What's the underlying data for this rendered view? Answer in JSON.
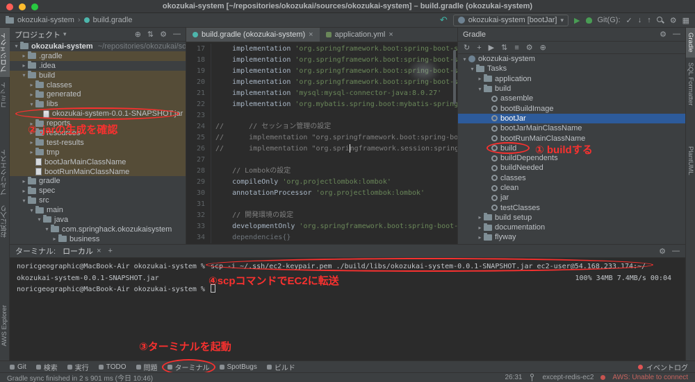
{
  "title_bar": {
    "title": "okozukai-system [~/repositories/okozukai/sources/okozukai-system] – build.gradle (okozukai-system)"
  },
  "navbar": {
    "breadcrumbs": [
      "okozukai-system",
      "build.gradle"
    ],
    "run_config": "okozukai-system [bootJar]",
    "git_widget": "Git(G):"
  },
  "left_stripe": [
    "プロジェクト",
    "コミット",
    "プルリクエスト",
    "お気に入り",
    "AWS Explorer"
  ],
  "right_stripe": [
    "Gradle",
    "SQL Formatter",
    "PlantUML"
  ],
  "project_panel": {
    "title": "プロジェクト",
    "tree": [
      {
        "label": "okozukai-system",
        "suffix": "~/repositories/okozukai/sources",
        "indent": 0,
        "arrow": "open",
        "type": "root"
      },
      {
        "label": ".gradle",
        "indent": 1,
        "arrow": "closed",
        "highlight": true
      },
      {
        "label": ".idea",
        "indent": 1,
        "arrow": "closed"
      },
      {
        "label": "build",
        "indent": 1,
        "arrow": "open",
        "highlight": true
      },
      {
        "label": "classes",
        "indent": 2,
        "arrow": "closed",
        "highlight": true
      },
      {
        "label": "generated",
        "indent": 2,
        "arrow": "closed",
        "highlight": true
      },
      {
        "label": "libs",
        "indent": 2,
        "arrow": "open",
        "highlight": true
      },
      {
        "label": "okozukai-system-0.0.1-SNAPSHOT.jar",
        "indent": 3,
        "type": "jar",
        "highlight": true
      },
      {
        "label": "reports",
        "indent": 2,
        "arrow": "closed",
        "highlight": true
      },
      {
        "label": "resources",
        "indent": 2,
        "arrow": "closed",
        "highlight": true
      },
      {
        "label": "test-results",
        "indent": 2,
        "arrow": "closed",
        "highlight": true
      },
      {
        "label": "tmp",
        "indent": 2,
        "arrow": "closed",
        "highlight": true
      },
      {
        "label": "bootJarMainClassName",
        "indent": 2,
        "type": "file",
        "highlight": true
      },
      {
        "label": "bootRunMainClassName",
        "indent": 2,
        "type": "file",
        "highlight": true
      },
      {
        "label": "gradle",
        "indent": 1,
        "arrow": "closed"
      },
      {
        "label": "spec",
        "indent": 1,
        "arrow": "closed"
      },
      {
        "label": "src",
        "indent": 1,
        "arrow": "open"
      },
      {
        "label": "main",
        "indent": 2,
        "arrow": "open"
      },
      {
        "label": "java",
        "indent": 3,
        "arrow": "open"
      },
      {
        "label": "com.springhack.okozukaisystem",
        "indent": 4,
        "arrow": "open"
      },
      {
        "label": "business",
        "indent": 5,
        "arrow": "closed"
      }
    ]
  },
  "editor": {
    "tabs": [
      {
        "label": "build.gradle (okozukai-system)",
        "active": true
      },
      {
        "label": "application.yml",
        "active": false
      }
    ],
    "lines": [
      {
        "n": 17,
        "parts": [
          {
            "t": "    implementation ",
            "c": "p"
          },
          {
            "t": "'org.springframework.boot:spring-boot-sta",
            "c": "s"
          }
        ]
      },
      {
        "n": 18,
        "parts": [
          {
            "t": "    implementation ",
            "c": "p"
          },
          {
            "t": "'org.springframework.boot:spring-boot-starter",
            "c": "s"
          }
        ]
      },
      {
        "n": 19,
        "parts": [
          {
            "t": "    implementation ",
            "c": "p"
          },
          {
            "t": "'org.springframework.boot:spring-boot-starter",
            "c": "s"
          }
        ]
      },
      {
        "n": 20,
        "parts": [
          {
            "t": "    implementation ",
            "c": "p"
          },
          {
            "t": "'org.springframework.boot:spring-boot-sta",
            "c": "s"
          }
        ]
      },
      {
        "n": 21,
        "parts": [
          {
            "t": "    implementation ",
            "c": "p"
          },
          {
            "t": "'mysql:mysql-connector-java:8.0.27'",
            "c": "s"
          }
        ]
      },
      {
        "n": 22,
        "parts": [
          {
            "t": "    implementation ",
            "c": "p"
          },
          {
            "t": "'org.mybatis.spring.boot:mybatis-spring-boo",
            "c": "s"
          }
        ]
      },
      {
        "n": 23,
        "parts": []
      },
      {
        "n": 24,
        "parts": [
          {
            "t": "//      // セッション管理の設定",
            "c": "c"
          }
        ]
      },
      {
        "n": 25,
        "parts": [
          {
            "t": "//      implementation \"org.springframework.boot:spring-boot-st",
            "c": "c"
          }
        ]
      },
      {
        "n": 26,
        "parts": [
          {
            "t": "//      implementation \"org.spri",
            "c": "c"
          },
          {
            "t": "",
            "c": "caret"
          },
          {
            "t": "ngframework.session:spring-sessio",
            "c": "c"
          }
        ]
      },
      {
        "n": 27,
        "parts": []
      },
      {
        "n": 28,
        "parts": [
          {
            "t": "    // Lombokの設定",
            "c": "c"
          }
        ]
      },
      {
        "n": 29,
        "parts": [
          {
            "t": "    compileOnly ",
            "c": "p"
          },
          {
            "t": "'org.projectlombok:lombok'",
            "c": "s"
          }
        ]
      },
      {
        "n": 30,
        "parts": [
          {
            "t": "    annotationProcessor ",
            "c": "p"
          },
          {
            "t": "'org.projectlombok:lombok'",
            "c": "s"
          }
        ]
      },
      {
        "n": 31,
        "parts": []
      },
      {
        "n": 32,
        "parts": [
          {
            "t": "    // 開発環境の設定",
            "c": "c"
          }
        ]
      },
      {
        "n": 33,
        "parts": [
          {
            "t": "    developmentOnly ",
            "c": "p"
          },
          {
            "t": "'org.springframework.boot:spring-boot-devt",
            "c": "s"
          }
        ]
      },
      {
        "n": 34,
        "parts": [
          {
            "t": "    dependencies{}",
            "c": "dim"
          }
        ]
      }
    ]
  },
  "gradle_panel": {
    "title": "Gradle",
    "toolbar_icons": [
      "refresh",
      "plus",
      "execute",
      "sort",
      "menu",
      "gear",
      "target"
    ],
    "tree": [
      {
        "label": "okozukai-system",
        "indent": 0,
        "arrow": "open",
        "type": "groot"
      },
      {
        "label": "Tasks",
        "indent": 1,
        "arrow": "open",
        "type": "folder"
      },
      {
        "label": "application",
        "indent": 2,
        "arrow": "closed",
        "type": "folder"
      },
      {
        "label": "build",
        "indent": 2,
        "arrow": "open",
        "type": "folder"
      },
      {
        "label": "assemble",
        "indent": 3,
        "type": "task"
      },
      {
        "label": "bootBuildImage",
        "indent": 3,
        "type": "task"
      },
      {
        "label": "bootJar",
        "indent": 3,
        "type": "task",
        "selected": true
      },
      {
        "label": "bootJarMainClassName",
        "indent": 3,
        "type": "task"
      },
      {
        "label": "bootRunMainClassName",
        "indent": 3,
        "type": "task"
      },
      {
        "label": "build",
        "indent": 3,
        "type": "task"
      },
      {
        "label": "buildDependents",
        "indent": 3,
        "type": "task"
      },
      {
        "label": "buildNeeded",
        "indent": 3,
        "type": "task"
      },
      {
        "label": "classes",
        "indent": 3,
        "type": "task"
      },
      {
        "label": "clean",
        "indent": 3,
        "type": "task"
      },
      {
        "label": "jar",
        "indent": 3,
        "type": "task"
      },
      {
        "label": "testClasses",
        "indent": 3,
        "type": "task"
      },
      {
        "label": "build setup",
        "indent": 2,
        "arrow": "closed",
        "type": "folder"
      },
      {
        "label": "documentation",
        "indent": 2,
        "arrow": "closed",
        "type": "folder"
      },
      {
        "label": "flyway",
        "indent": 2,
        "arrow": "closed",
        "type": "folder"
      }
    ]
  },
  "terminal": {
    "label": "ターミナル:",
    "tab": "ローカル",
    "prompt": "noricgeographic@MacBook-Air okozukai-system %",
    "command": "scp -i ~/.ssh/ec2-keypair.pem ./build/libs/okozukai-system-0.0.1-SNAPSHOT.jar ec2-user@54.168.233.174:~/",
    "transfer_file": "okozukai-system-0.0.1-SNAPSHOT.jar",
    "transfer_stats": "100%   34MB   7.4MB/s   00:04"
  },
  "bottom_bar": {
    "items": [
      "Git",
      "検索",
      "実行",
      "TODO",
      "問題",
      "ターミナル",
      "SpotBugs",
      "ビルド"
    ],
    "event_log": "イベントログ"
  },
  "status_bar": {
    "message": "Gradle sync finished in 2 s 901 ms (今日 10:46)",
    "caret": "26:31",
    "branch": "except-redis-ec2",
    "aws_status": "AWS: Unable to connect"
  },
  "annotations": {
    "step1": "① buildする",
    "step2": "② .jarの生成を確認",
    "step3": "③ターミナルを起動",
    "step4": "④scpコマンドでEC2に転送"
  },
  "icons": {
    "chevron": "›",
    "caret-down": "▾",
    "close": "×",
    "plus": "+",
    "minus": "—",
    "gear": "⚙",
    "refresh": "↻",
    "check": "✓",
    "arrow-down": "↓",
    "arrow-up": "↑",
    "run": "▶",
    "execute": "▶",
    "back-arrow": "↶",
    "grid": "▦",
    "sort": "⇅",
    "menu": "≡",
    "target": "⊕",
    "arrow-expanded": "▾",
    "arrow-collapsed": "▸"
  },
  "colors": {
    "annotation_red": "#f8312f",
    "selection_blue": "#2d5b9b",
    "excluded_olive": "#554c37",
    "editor_bg": "#2b2b2b",
    "panel_bg": "#3c3f41"
  }
}
